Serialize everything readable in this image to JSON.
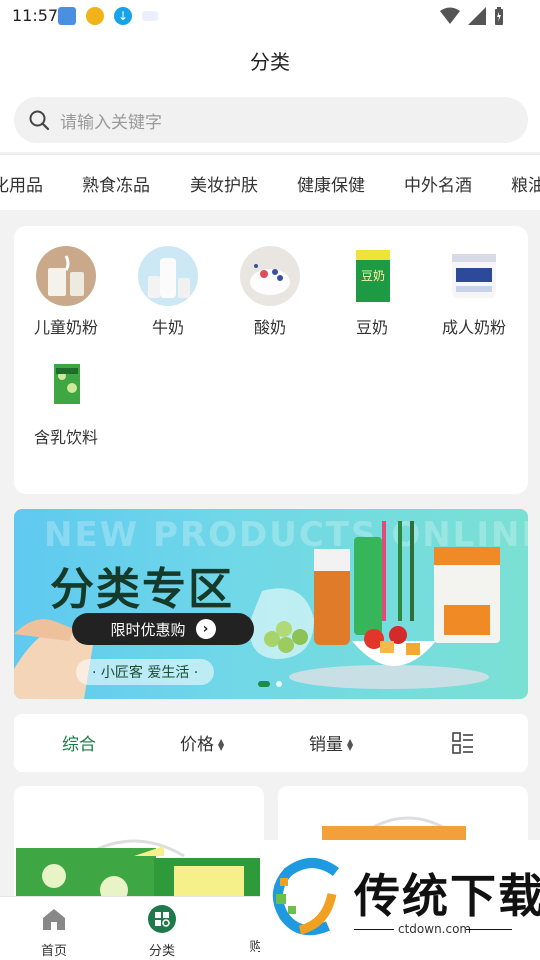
{
  "status_bar": {
    "time": "11:57"
  },
  "header": {
    "title": "分类"
  },
  "search": {
    "placeholder": "请输入关键字"
  },
  "category_tabs": [
    "化用品",
    "熟食冻品",
    "美妆护肤",
    "健康保健",
    "中外名酒",
    "粮油"
  ],
  "subcategories": [
    {
      "label": "儿童奶粉",
      "icon": "milk-powder-image"
    },
    {
      "label": "牛奶",
      "icon": "milk-bottle-image"
    },
    {
      "label": "酸奶",
      "icon": "yogurt-image"
    },
    {
      "label": "豆奶",
      "icon": "soy-milk-box-image"
    },
    {
      "label": "成人奶粉",
      "icon": "adult-milk-powder-can-image"
    },
    {
      "label": "含乳饮料",
      "icon": "milk-drink-box-image"
    }
  ],
  "banner": {
    "bg_text": "NEW PRODUCTS ONLINE",
    "title": "分类专区",
    "button": "限时优惠购",
    "slogan": "· 小匠客 爱生活 ·",
    "slide_index": 1,
    "slide_count": 2
  },
  "sort_bar": {
    "items": [
      "综合",
      "价格",
      "销量"
    ],
    "active": "综合",
    "layout_icon": "list-grid-icon"
  },
  "bottom_nav": {
    "items": [
      "首页",
      "分类",
      "购"
    ],
    "active": "分类"
  },
  "watermark": {
    "text": "传统下载",
    "url": "ctdown.com"
  },
  "colors": {
    "accent": "#1e7a4a",
    "banner": "#63cdec"
  }
}
